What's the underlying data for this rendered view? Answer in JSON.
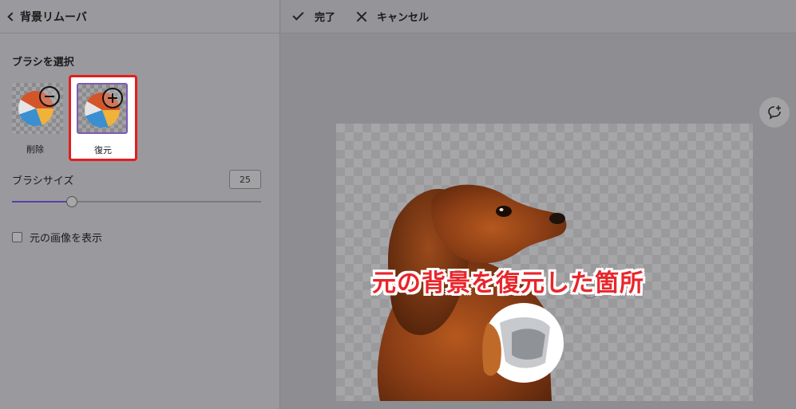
{
  "left_panel": {
    "back_title": "背景リムーバ",
    "brush_section_title": "ブラシを選択",
    "brushes": [
      {
        "label": "削除",
        "badge": "minus-icon"
      },
      {
        "label": "復元",
        "badge": "plus-icon",
        "selected": true
      }
    ],
    "brush_size_label": "ブラシサイズ",
    "brush_size_value": "25",
    "brush_size_fraction": 0.24,
    "show_original_label": "元の画像を表示",
    "show_original_checked": false
  },
  "topbar": {
    "done_label": "完了",
    "cancel_label": "キャンセル"
  },
  "canvas": {
    "annotation": "元の背景を復元した箇所"
  },
  "colors": {
    "highlight_border": "#e51d1d",
    "annotation_text": "#e8262b",
    "accent": "#5a3ea4"
  }
}
